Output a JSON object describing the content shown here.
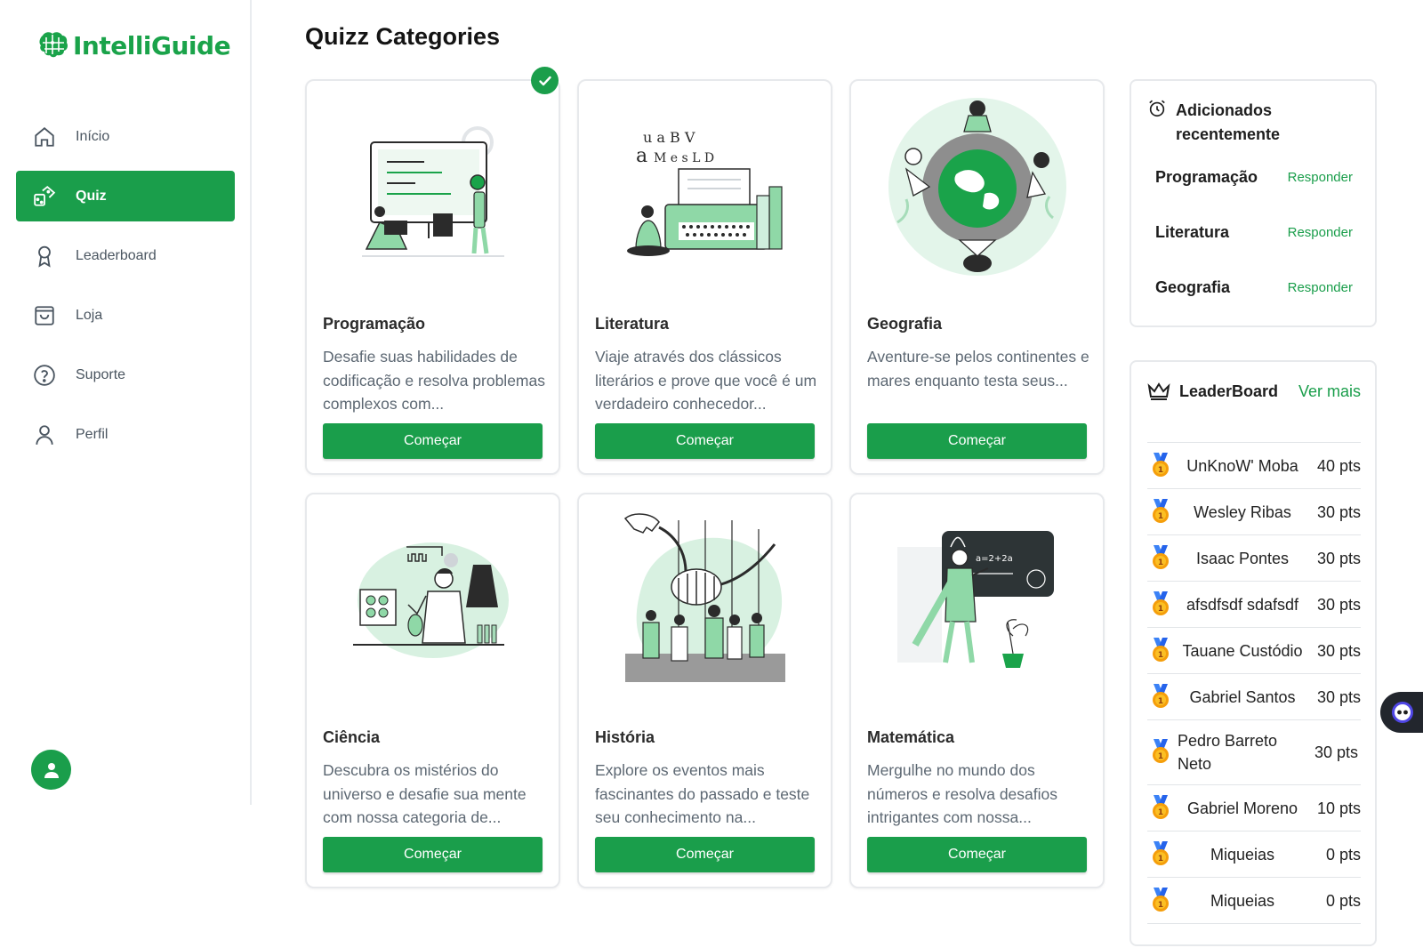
{
  "app": {
    "brand": "IntelliGuide",
    "brand_color": "#1a9e4b"
  },
  "sidebar": {
    "items": [
      {
        "label": "Início",
        "icon": "home-icon",
        "active": false
      },
      {
        "label": "Quiz",
        "icon": "quiz-icon",
        "active": true
      },
      {
        "label": "Leaderboard",
        "icon": "ribbon-icon",
        "active": false
      },
      {
        "label": "Loja",
        "icon": "shopping-bag-icon",
        "active": false
      },
      {
        "label": "Suporte",
        "icon": "help-circle-icon",
        "active": false
      },
      {
        "label": "Perfil",
        "icon": "user-icon",
        "active": false
      }
    ],
    "profile_icon": "user-avatar-icon"
  },
  "main": {
    "title": "Quizz Categories",
    "categories": [
      {
        "title": "Programação",
        "description": "Desafie suas habilidades de codificação e resolva problemas complexos com...",
        "button": "Começar",
        "completed": true,
        "illustration": "programming-illustration"
      },
      {
        "title": "Literatura",
        "description": "Viaje através dos clássicos literários e prove que você é um verdadeiro conhecedor...",
        "button": "Começar",
        "completed": false,
        "illustration": "typewriter-illustration"
      },
      {
        "title": "Geografia",
        "description": "Aventure-se pelos continentes e mares enquanto testa seus...",
        "button": "Começar",
        "completed": false,
        "illustration": "globe-illustration"
      },
      {
        "title": "Ciência",
        "description": "Descubra os mistérios do universo e desafie sua mente com nossa categoria de...",
        "button": "Começar",
        "completed": false,
        "illustration": "science-lab-illustration"
      },
      {
        "title": "História",
        "description": "Explore os eventos mais fascinantes do passado e teste seu conhecimento na...",
        "button": "Começar",
        "completed": false,
        "illustration": "dinosaur-museum-illustration"
      },
      {
        "title": "Matemática",
        "description": "Mergulhe no mundo dos números e resolva desafios intrigantes com nossa...",
        "button": "Começar",
        "completed": false,
        "illustration": "math-teacher-illustration"
      }
    ]
  },
  "recent": {
    "title": "Adicionados recentemente",
    "icon": "alarm-clock-icon",
    "items": [
      {
        "name": "Programação",
        "action": "Responder"
      },
      {
        "name": "Literatura",
        "action": "Responder"
      },
      {
        "name": "Geografia",
        "action": "Responder"
      }
    ]
  },
  "leaderboard": {
    "title": "LeaderBoard",
    "icon": "crown-icon",
    "more": "Ver mais",
    "medal_icon": "medal-icon",
    "rows": [
      {
        "name": "UnKnoW' Moba",
        "points": "40 pts"
      },
      {
        "name": "Wesley Ribas",
        "points": "30 pts"
      },
      {
        "name": "Isaac Pontes",
        "points": "30 pts"
      },
      {
        "name": "afsdfsdf sdafsdf",
        "points": "30 pts"
      },
      {
        "name": "Tauane Custódio",
        "points": "30 pts"
      },
      {
        "name": "Gabriel Santos",
        "points": "30 pts"
      },
      {
        "name": "Pedro Barreto Neto",
        "points": "30 pts"
      },
      {
        "name": "Gabriel Moreno",
        "points": "10 pts"
      },
      {
        "name": "Miqueias",
        "points": "0 pts"
      },
      {
        "name": "Miqueias",
        "points": "0 pts"
      }
    ]
  },
  "chat": {
    "icon": "chat-bot-icon"
  }
}
